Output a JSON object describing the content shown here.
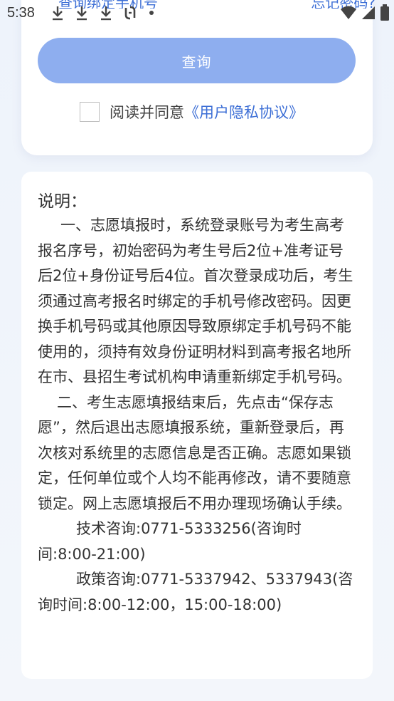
{
  "status_bar": {
    "time": "5:38"
  },
  "header_links": {
    "left": "查询绑定手机号",
    "right": "忘记密码?"
  },
  "query": {
    "button_label": "查询",
    "agree_prefix": "阅读并同意",
    "privacy_link": "《用户隐私协议》"
  },
  "info": {
    "title": "说明：",
    "paragraphs": [
      "一、志愿填报时，系统登录账号为考生高考报名序号，初始密码为考生号后2位+准考证号后2位+身份证号后4位。首次登录成功后，考生须通过高考报名时绑定的手机号修改密码。因更换手机号码或其他原因导致原绑定手机号码不能使用的，须持有效身份证明材料到高考报名地所在市、县招生考试机构申请重新绑定手机号码。",
      "二、考生志愿填报结束后，先点击“保存志愿”，然后退出志愿填报系统，重新登录后，再次核对系统里的志愿信息是否正确。志愿如果锁定，任何单位或个人均不能再修改，请不要随意锁定。网上志愿填报后不用办理现场确认手续。",
      "技术咨询:0771-5333256(咨询时间:8:00-21:00)",
      "政策咨询:0771-5337942、5337943(咨询时间:8:00-12:00，15:00-18:00)"
    ]
  },
  "colors": {
    "accent": "#3d6fd6",
    "button": "#8eaeef",
    "card": "#ffffff",
    "background": "#eef3fb"
  }
}
